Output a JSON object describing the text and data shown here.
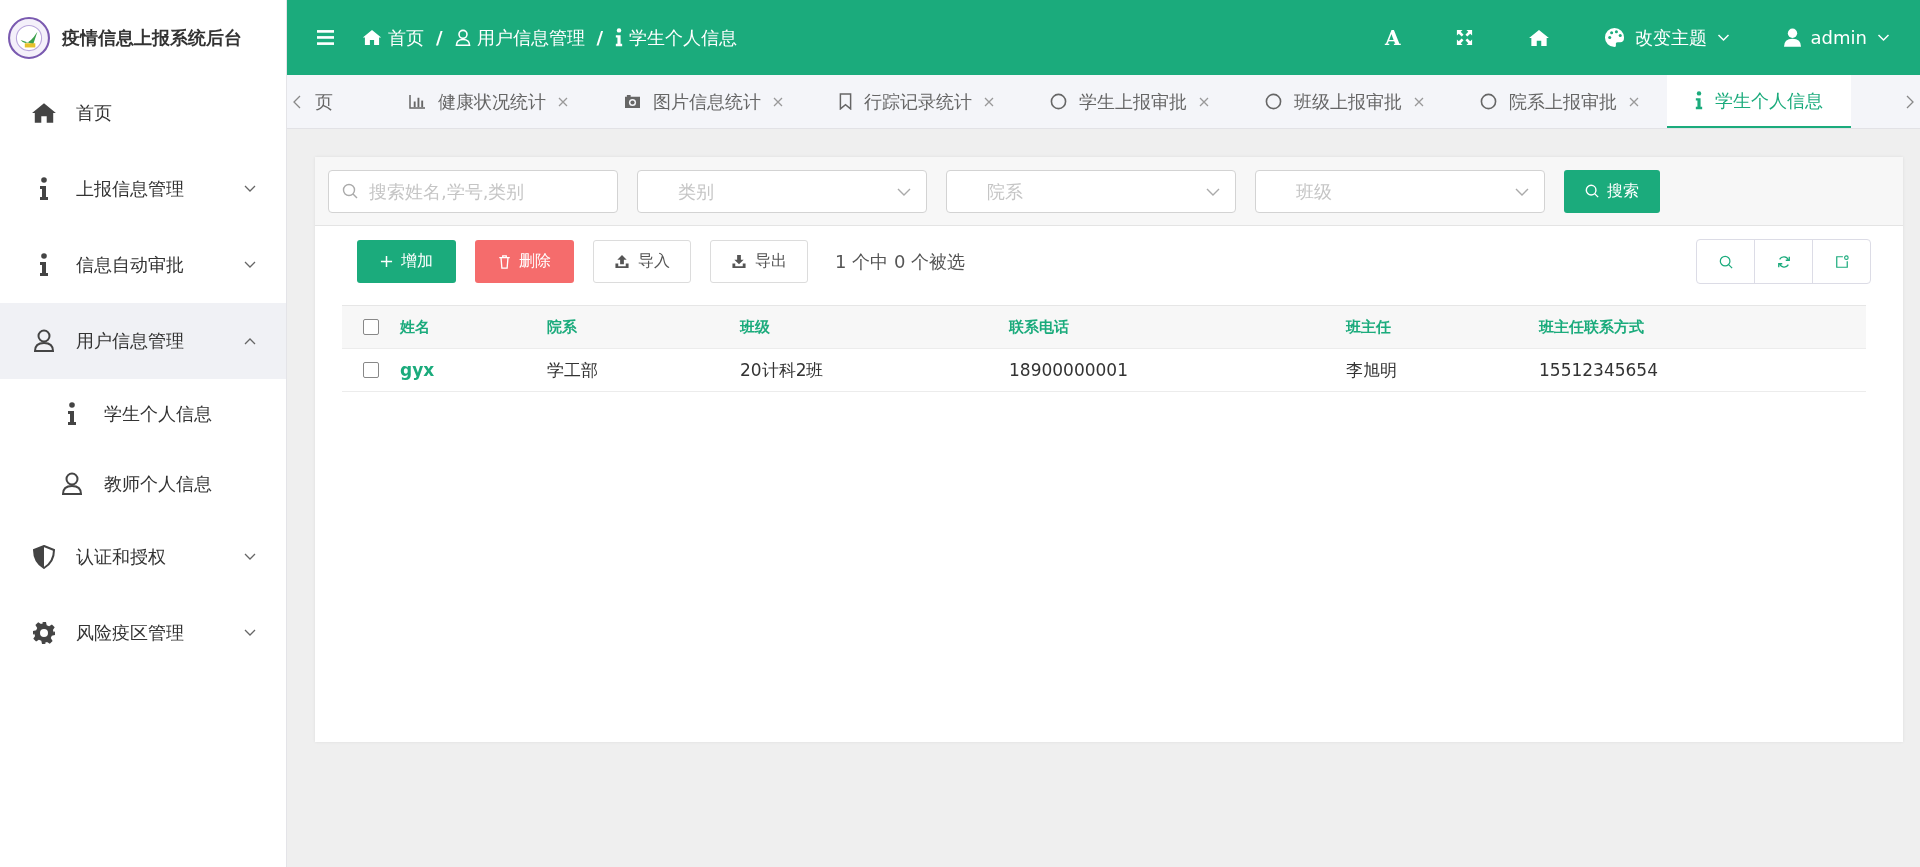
{
  "app": {
    "title": "疫情信息上报系统后台"
  },
  "breadcrumb": {
    "items": [
      "首页",
      "用户信息管理",
      "学生个人信息"
    ],
    "separators": [
      "/",
      "/"
    ]
  },
  "header_actions": {
    "font_button": "A",
    "theme": "改变主题",
    "user": "admin"
  },
  "sidebar": {
    "items": [
      {
        "label": "首页",
        "selected": false
      },
      {
        "label": "上报信息管理",
        "selected": false,
        "expanded": false
      },
      {
        "label": "信息自动审批",
        "selected": false,
        "expanded": false
      },
      {
        "label": "用户信息管理",
        "selected": true,
        "expanded": true,
        "children": [
          {
            "label": "学生个人信息"
          },
          {
            "label": "教师个人信息"
          }
        ]
      },
      {
        "label": "认证和授权",
        "selected": false,
        "expanded": false
      },
      {
        "label": "风险疫区管理",
        "selected": false,
        "expanded": false
      }
    ]
  },
  "tabs": [
    {
      "label": "页",
      "selected": false,
      "closable": false
    },
    {
      "label": "健康状况统计",
      "selected": false,
      "closable": true
    },
    {
      "label": "图片信息统计",
      "selected": false,
      "closable": true
    },
    {
      "label": "行踪记录统计",
      "selected": false,
      "closable": true
    },
    {
      "label": "学生上报审批",
      "selected": false,
      "closable": true
    },
    {
      "label": "班级上报审批",
      "selected": false,
      "closable": true
    },
    {
      "label": "院系上报审批",
      "selected": false,
      "closable": true
    },
    {
      "label": "学生个人信息",
      "selected": true,
      "closable": false
    }
  ],
  "filters": {
    "search": {
      "placeholder": "搜索姓名,学号,类别"
    },
    "selects": [
      {
        "placeholder": "类别"
      },
      {
        "placeholder": "院系"
      },
      {
        "placeholder": "班级"
      }
    ],
    "button": "搜索"
  },
  "toolbar": {
    "buttons": [
      {
        "label": "增加",
        "kind": "add"
      },
      {
        "label": "删除",
        "kind": "delete"
      },
      {
        "label": "导入",
        "kind": "import"
      },
      {
        "label": "导出",
        "kind": "export"
      }
    ],
    "selection": "1 个中 0 个被选"
  },
  "table": {
    "all_checked": false,
    "columns": [
      "姓名",
      "院系",
      "班级",
      "联系电话",
      "班主任",
      "班主任联系方式"
    ],
    "rows": [
      {
        "checked": false,
        "cells": [
          "gyx",
          "学工部",
          "20计科2班",
          "18900000001",
          "李旭明",
          "15512345654"
        ]
      }
    ]
  }
}
